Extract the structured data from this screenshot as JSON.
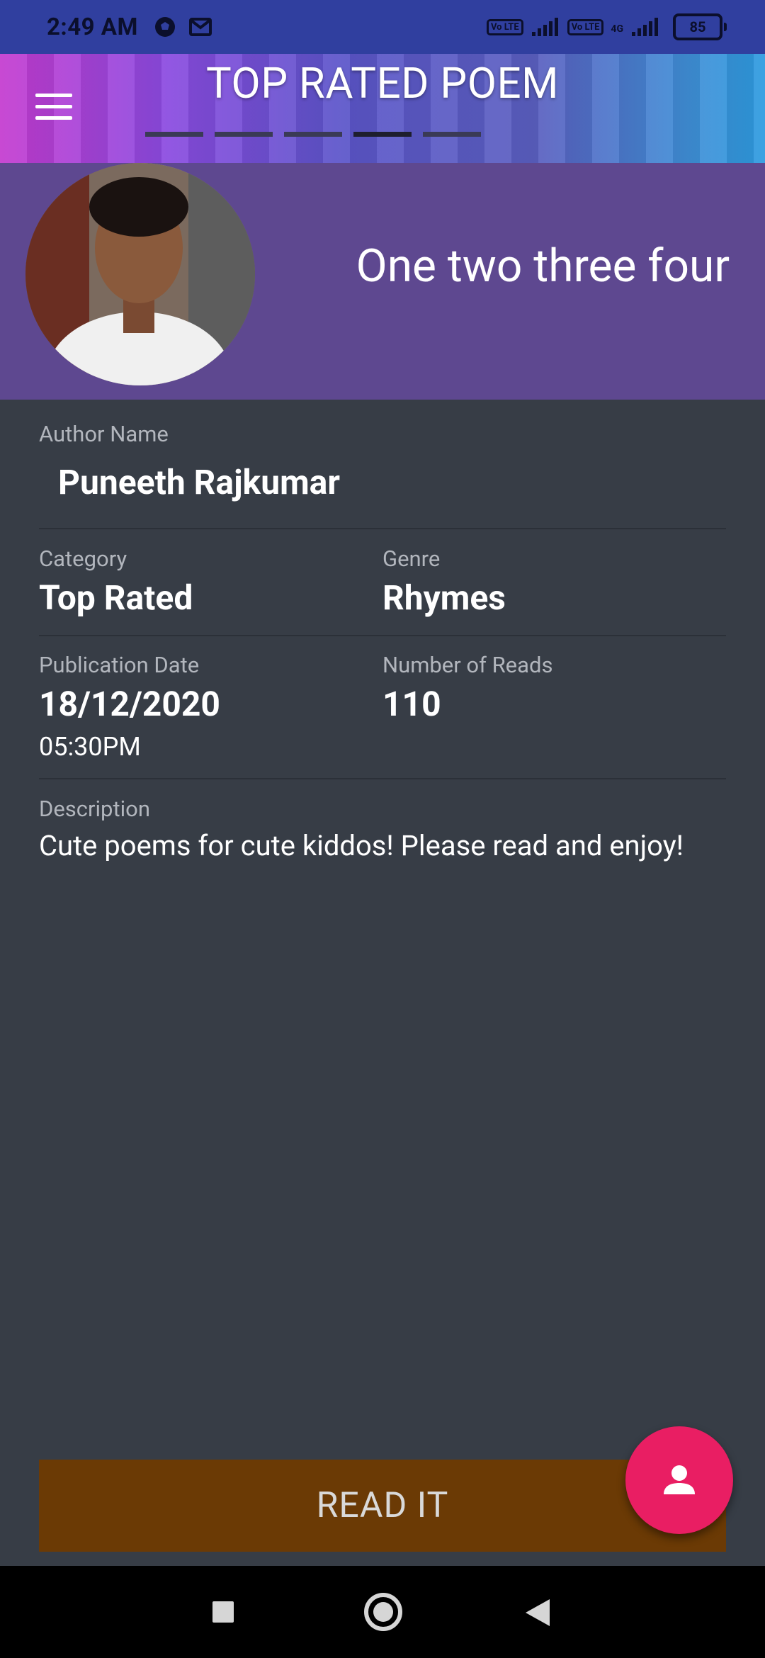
{
  "status_bar": {
    "time": "2:49 AM",
    "badge1": "Vo LTE",
    "badge2": "Vo LTE",
    "network": "4G",
    "battery": "85",
    "icons": [
      "soccer-ball-icon",
      "gmail-icon",
      "signal-icon",
      "signal-icon"
    ]
  },
  "app_bar": {
    "title": "TOP RATED POEM",
    "menu_icon": "menu-icon",
    "page_count": 5,
    "active_page": 4
  },
  "header": {
    "poem_title": "One two three four",
    "avatar_alt": "author avatar"
  },
  "details": {
    "author_label": "Author Name",
    "author_value": "Puneeth Rajkumar",
    "category_label": "Category",
    "category_value": "Top Rated",
    "genre_label": "Genre",
    "genre_value": "Rhymes",
    "pubdate_label": "Publication Date",
    "pubdate_value": "18/12/2020",
    "pubtime_value": "05:30PM",
    "reads_label": "Number of Reads",
    "reads_value": "110",
    "description_label": "Description",
    "description_value": "Cute poems for cute kiddos! Please read and enjoy!"
  },
  "actions": {
    "read_label": "READ IT",
    "fab_icon": "person-icon"
  },
  "colors": {
    "background": "#373d46",
    "header_card": "#5e4890",
    "read_button": "#6b3a05",
    "fab": "#e91e63",
    "status_bar": "#303f9f"
  },
  "nav_bar": {
    "icons": [
      "square-icon",
      "home-circle-icon",
      "back-triangle-icon"
    ]
  }
}
